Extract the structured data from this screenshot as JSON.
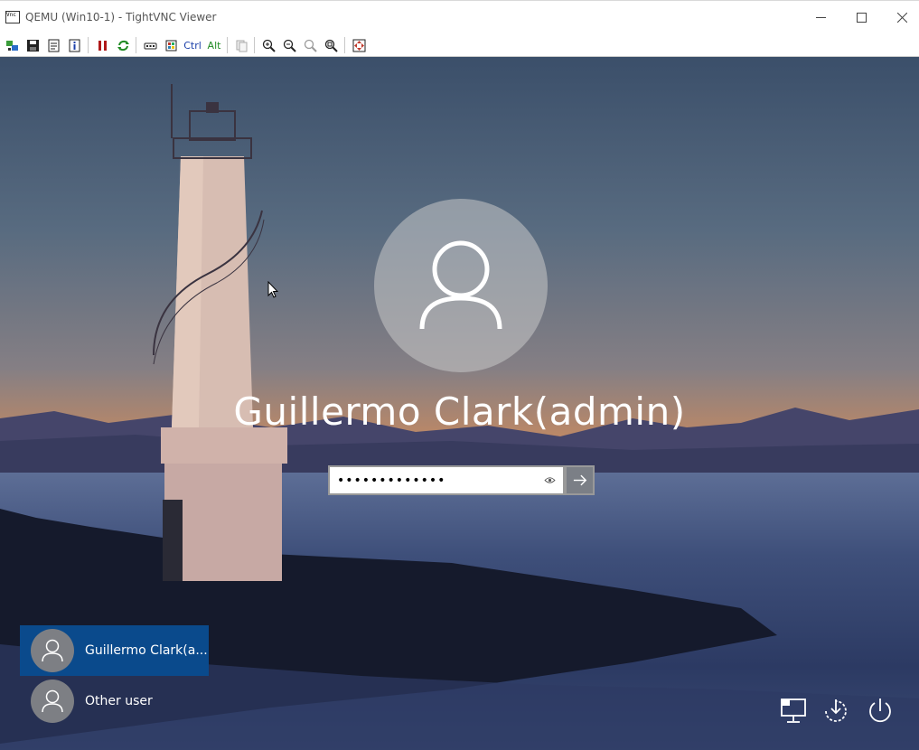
{
  "window": {
    "title": "QEMU (Win10-1) - TightVNC Viewer",
    "controls": [
      "minimize-icon",
      "maximize-icon",
      "close-icon"
    ]
  },
  "toolbar": {
    "ctrl_label": "Ctrl",
    "alt_label": "Alt",
    "buttons": [
      "new-connection-icon",
      "save-icon",
      "options-icon",
      "info-icon",
      "pause-icon",
      "refresh-icon",
      "send-ctrl-alt-del-icon",
      "send-ctrl-esc-icon",
      "ctrl-key-icon",
      "alt-key-icon",
      "clipboard-icon",
      "zoom-in-icon",
      "zoom-out-icon",
      "zoom-100-icon",
      "zoom-auto-icon",
      "fullscreen-icon"
    ]
  },
  "login": {
    "username": "Guillermo Clark(admin)",
    "password_masked": "•••••••••••••",
    "reveal_icon": "eye-icon",
    "submit_icon": "arrow-right-icon"
  },
  "users": [
    {
      "name": "Guillermo Clark(a...",
      "selected": true
    },
    {
      "name": "Other user",
      "selected": false
    }
  ],
  "corner_buttons": [
    "network-icon",
    "accessibility-icon",
    "power-icon"
  ],
  "colors": {
    "selected_user_bg": "#0a4a8c",
    "submit_bg": "#7b7f86"
  }
}
